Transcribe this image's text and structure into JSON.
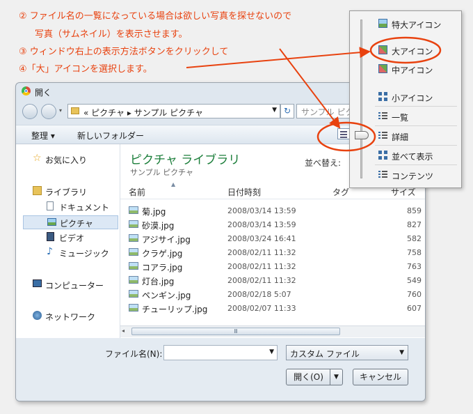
{
  "instructions": [
    "② ファイル名の一覧になっている場合は欲しい写真を探せないので",
    "写真（サムネイル）を表示させます。",
    "③ ウィンドウ右上の表示方法ボタンをクリックして",
    "④「大」アイコンを選択します。"
  ],
  "accent_color": "#e8420f",
  "dialog": {
    "title": "開く",
    "address": {
      "prefix": "«",
      "path": "ピクチャ ▸ サンプル ピクチャ"
    },
    "search_placeholder": "サンプル ピクチャ",
    "toolbar": {
      "organize": "整理 ▾",
      "new_folder": "新しいフォルダー"
    },
    "nav": {
      "favorites": "お気に入り",
      "libraries": "ライブラリ",
      "documents": "ドキュメント",
      "pictures": "ピクチャ",
      "videos": "ビデオ",
      "music": "ミュージック",
      "computer": "コンピューター",
      "network": "ネットワーク"
    },
    "library_title": "ピクチャ ライブラリ",
    "library_subtitle": "サンプル ピクチャ",
    "sort_by": "並べ替え:",
    "columns": {
      "name": "名前",
      "date": "日付時刻",
      "tags": "タグ",
      "size": "サイズ"
    },
    "files": [
      {
        "name": "菊.jpg",
        "date": "2008/03/14 13:59",
        "size": "859"
      },
      {
        "name": "砂漠.jpg",
        "date": "2008/03/14 13:59",
        "size": "827"
      },
      {
        "name": "アジサイ.jpg",
        "date": "2008/03/24 16:41",
        "size": "582"
      },
      {
        "name": "クラゲ.jpg",
        "date": "2008/02/11 11:32",
        "size": "758"
      },
      {
        "name": "コアラ.jpg",
        "date": "2008/02/11 11:32",
        "size": "763"
      },
      {
        "name": "灯台.jpg",
        "date": "2008/02/11 11:32",
        "size": "549"
      },
      {
        "name": "ペンギン.jpg",
        "date": "2008/02/18 5:07",
        "size": "760"
      },
      {
        "name": "チューリップ.jpg",
        "date": "2008/02/07 11:33",
        "size": "607"
      }
    ],
    "filename_label": "ファイル名(N):",
    "filename_value": "",
    "filetype": "カスタム ファイル",
    "open_button": "開く(O)",
    "cancel_button": "キャンセル"
  },
  "view_menu": {
    "items": [
      "特大アイコン",
      "大アイコン",
      "中アイコン",
      "小アイコン",
      "一覧",
      "詳細",
      "並べて表示",
      "コンテンツ"
    ],
    "selected": "大アイコン"
  }
}
